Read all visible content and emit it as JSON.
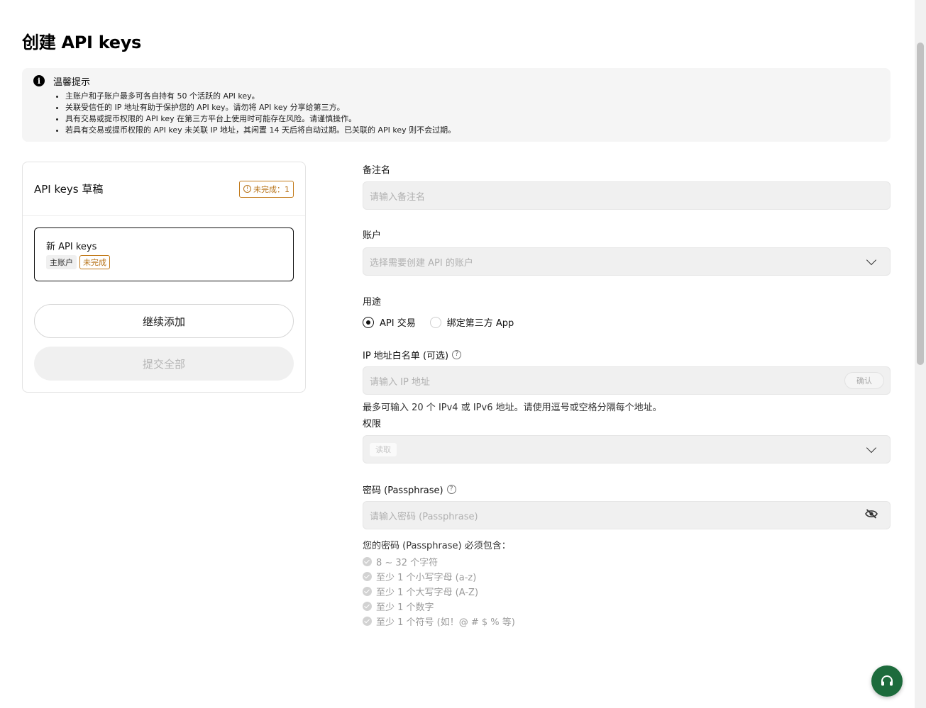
{
  "page": {
    "title": "创建 API keys"
  },
  "notice": {
    "title": "温馨提示",
    "items": [
      "主账户和子账户最多可各自持有 50 个活跃的 API key。",
      "关联受信任的 IP 地址有助于保护您的 API key。请勿将 API key 分享给第三方。",
      "具有交易或提币权限的 API key 在第三方平台上使用时可能存在风险。请谨慎操作。",
      "若具有交易或提币权限的 API key 未关联 IP 地址，其闲置 14 天后将自动过期。已关联的 API key 则不会过期。"
    ]
  },
  "drafts": {
    "title": "API keys 草稿",
    "badge": "未完成：1",
    "card": {
      "name": "新 API keys",
      "tag_account": "主账户",
      "tag_status": "未完成"
    },
    "add_button": "继续添加",
    "submit_button": "提交全部"
  },
  "form": {
    "note_label": "备注名",
    "note_placeholder": "请输入备注名",
    "account_label": "账户",
    "account_placeholder": "选择需要创建 API 的账户",
    "purpose_label": "用途",
    "purpose_options": [
      {
        "label": "API 交易",
        "selected": true
      },
      {
        "label": "绑定第三方 App",
        "selected": false
      }
    ],
    "ip_label": "IP 地址白名单 (可选)",
    "ip_placeholder": "请输入 IP 地址",
    "ip_confirm": "确认",
    "ip_hint": "最多可输入 20 个 IPv4 或 IPv6 地址。请使用逗号或空格分隔每个地址。",
    "perm_label": "权限",
    "perm_value": "读取",
    "pass_label": "密码 (Passphrase)",
    "pass_placeholder": "请输入密码 (Passphrase)",
    "pass_req_title": "您的密码 (Passphrase) 必须包含：",
    "pass_requirements": [
      "8 ~ 32 个字符",
      "至少 1 个小写字母 (a-z)",
      "至少 1 个大写字母 (A-Z)",
      "至少 1 个数字",
      "至少 1 个符号 (如！@ # $ % 等)"
    ]
  },
  "colors": {
    "accent": "#121212",
    "warning": "#b8741a",
    "support": "#1d6b3c",
    "field_bg": "#f0f0f0"
  },
  "icons": {
    "info": "info-icon",
    "help": "help-icon",
    "chevron": "chevron-down-icon",
    "eye": "eye-off-icon",
    "support": "headset-icon"
  }
}
